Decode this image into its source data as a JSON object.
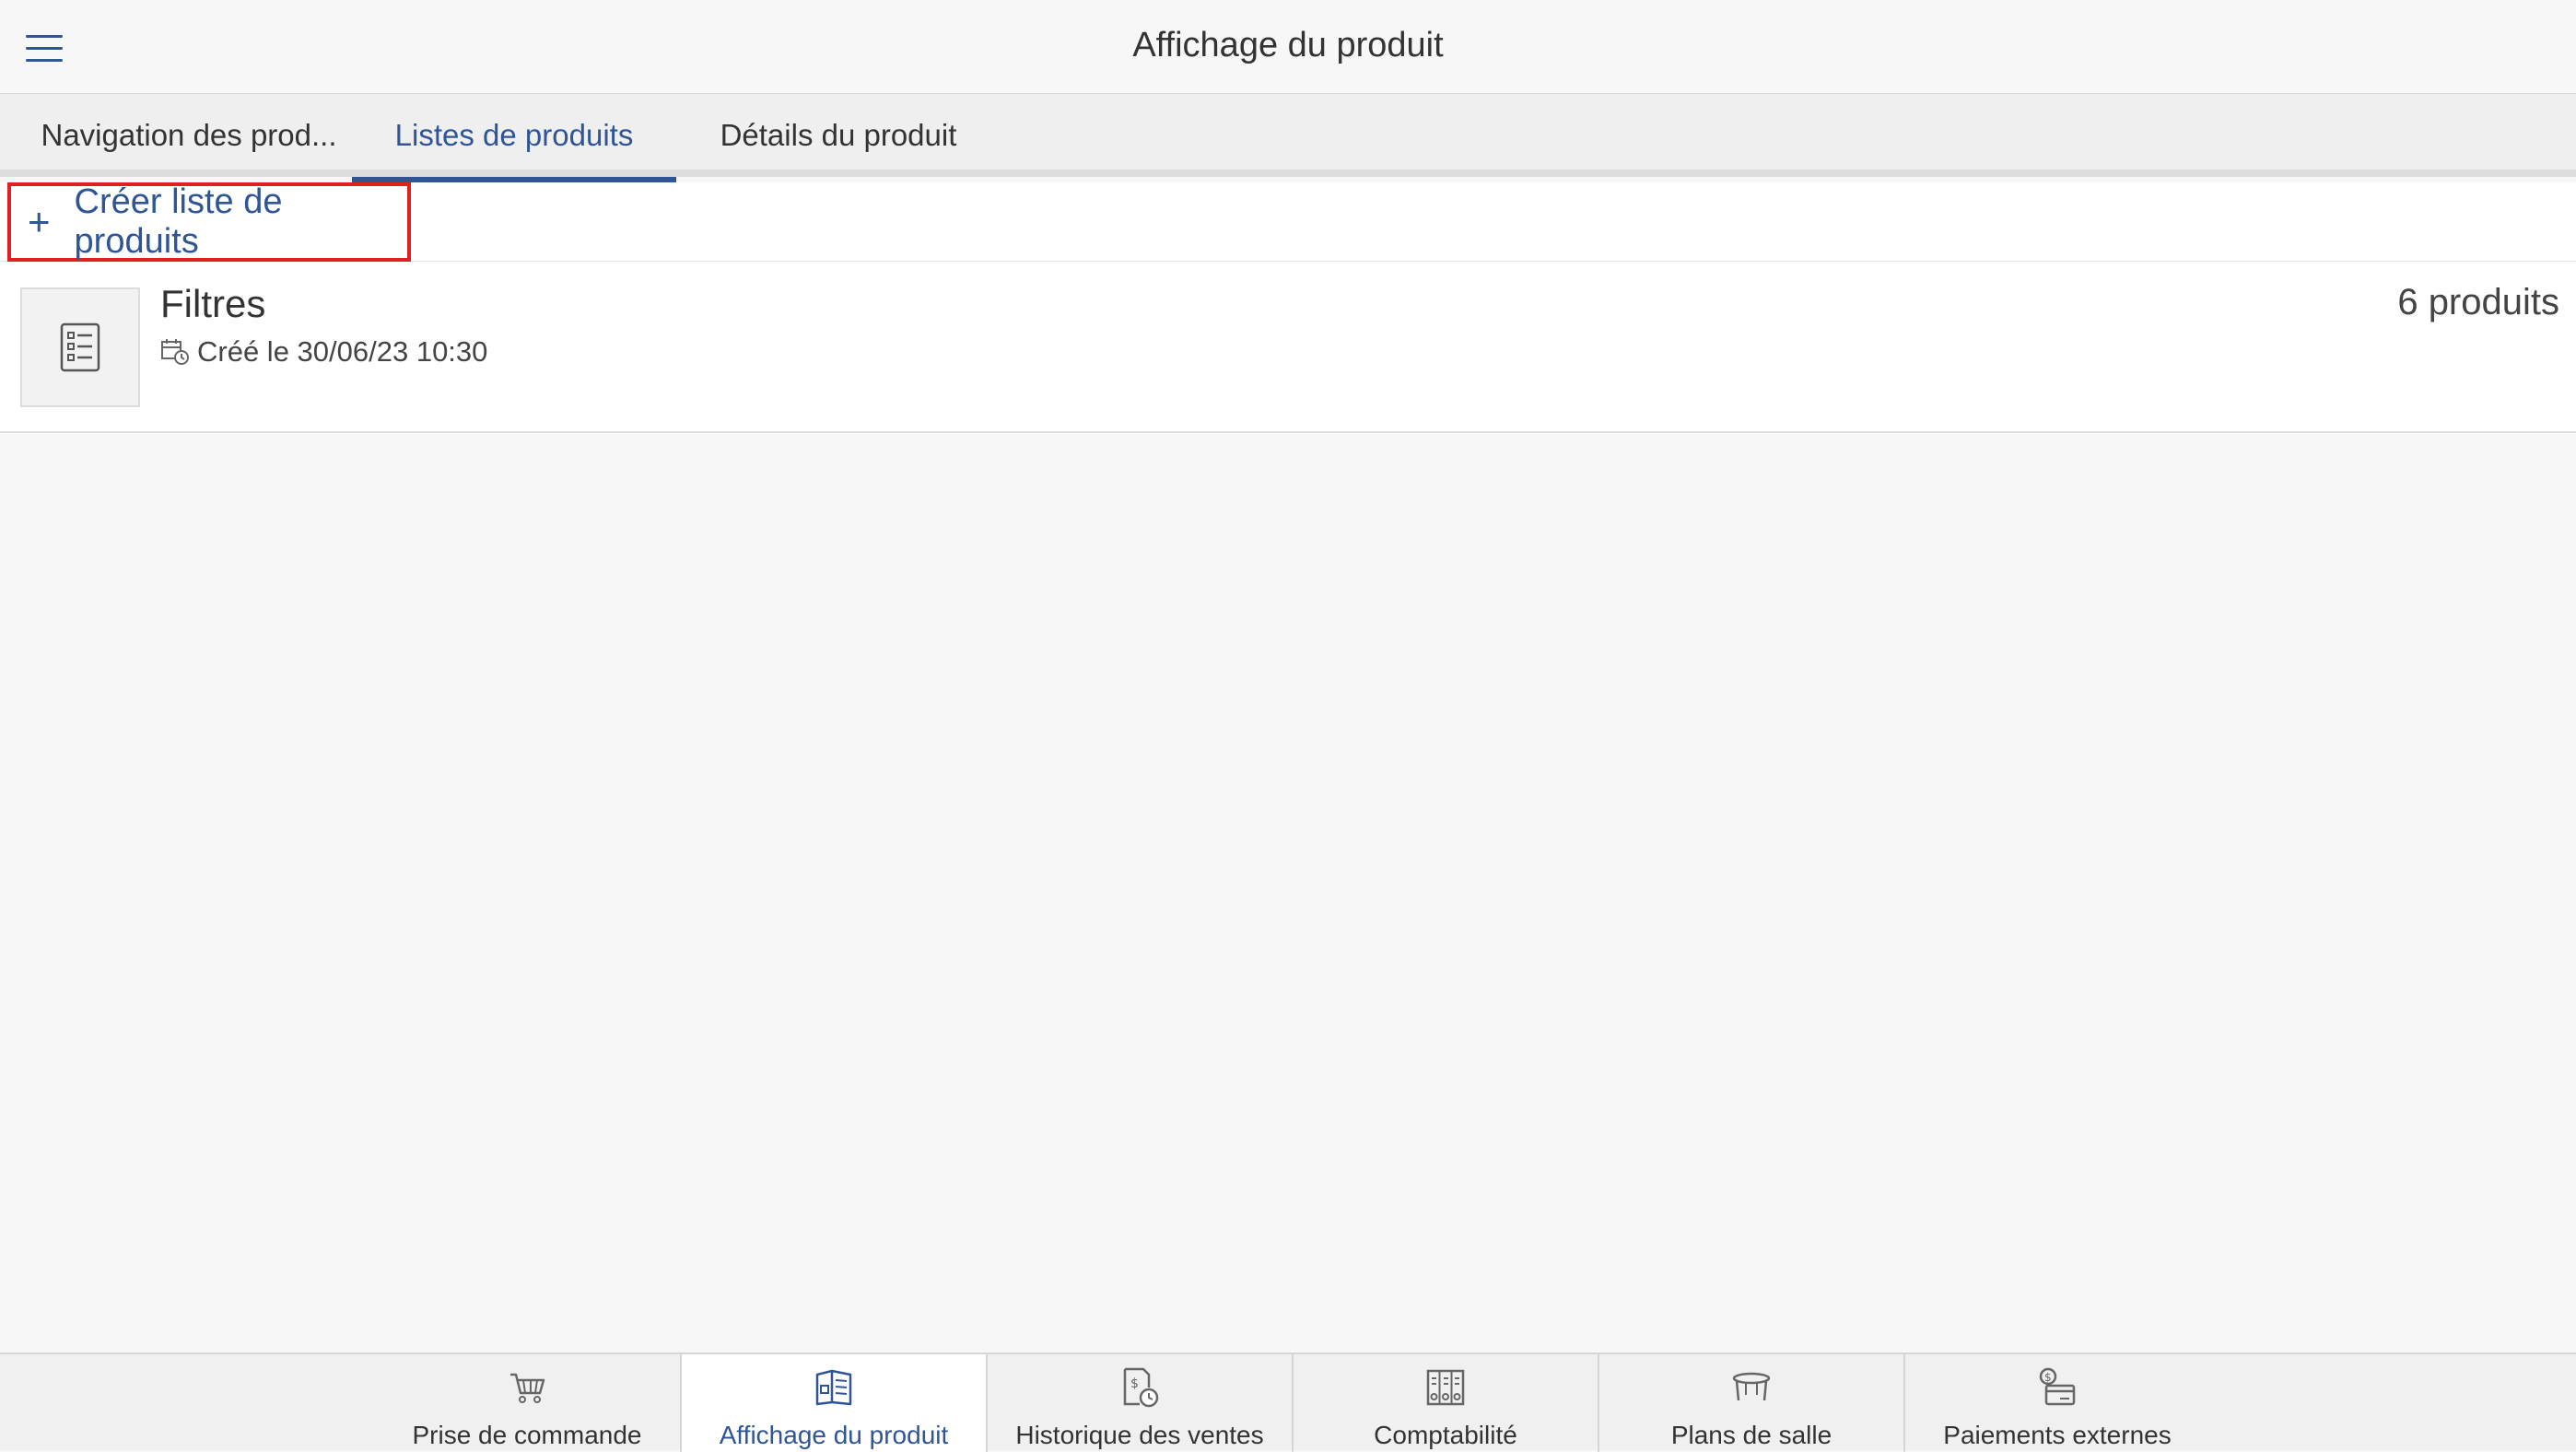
{
  "header": {
    "menu_icon": "hamburger-menu-icon",
    "title": "Affichage du produit"
  },
  "tabs": [
    {
      "label": "Navigation des prod...",
      "active": false
    },
    {
      "label": "Listes de produits",
      "active": true
    },
    {
      "label": "Détails du produit",
      "active": false
    }
  ],
  "actions": {
    "create_label": "Créer liste de produits",
    "create_icon": "plus-icon"
  },
  "product_lists": [
    {
      "title": "Filtres",
      "created": "Créé le 30/06/23 10:30",
      "count": "6 produits",
      "icon": "checklist-icon"
    }
  ],
  "bottom_nav": [
    {
      "label": "Prise de commande",
      "icon": "cart-icon",
      "active": false
    },
    {
      "label": "Affichage du produit",
      "icon": "product-display-icon",
      "active": true
    },
    {
      "label": "Historique des ventes",
      "icon": "sales-history-icon",
      "active": false
    },
    {
      "label": "Comptabilité",
      "icon": "accounting-icon",
      "active": false
    },
    {
      "label": "Plans de salle",
      "icon": "table-icon",
      "active": false
    },
    {
      "label": "Paiements externes",
      "icon": "external-payment-icon",
      "active": false
    }
  ],
  "colors": {
    "accent": "#2f5597",
    "highlight_border": "#e02020",
    "background": "#f7f7f7"
  }
}
